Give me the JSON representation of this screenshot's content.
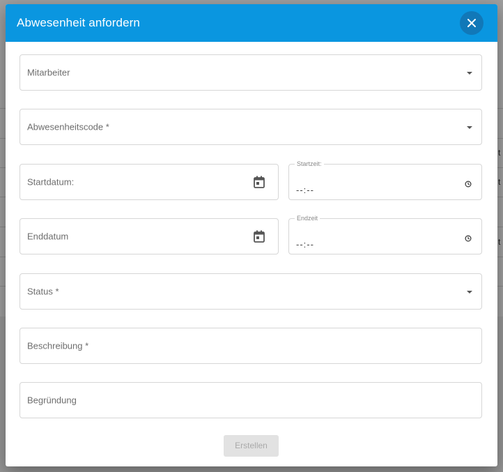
{
  "dialog": {
    "title": "Abwesenheit anfordern",
    "close_icon": "close-icon",
    "header_color": "#0a96e0"
  },
  "form": {
    "employee": {
      "label": "Mitarbeiter"
    },
    "absence_code": {
      "label": "Abwesenheitscode *"
    },
    "start_date": {
      "label": "Startdatum:",
      "icon": "calendar-icon"
    },
    "start_time": {
      "legend": "Startzeit:",
      "value": "--:--",
      "icon": "clock-icon"
    },
    "end_date": {
      "label": "Enddatum",
      "icon": "calendar-icon"
    },
    "end_time": {
      "legend": "Endzeit",
      "value": "--:--",
      "icon": "clock-icon"
    },
    "status": {
      "label": "Status *"
    },
    "description": {
      "label": "Beschreibung *"
    },
    "reason": {
      "label": "Begründung"
    },
    "submit_label": "Erstellen"
  },
  "background": {
    "edge_chars": [
      "t",
      "t",
      "t"
    ]
  }
}
